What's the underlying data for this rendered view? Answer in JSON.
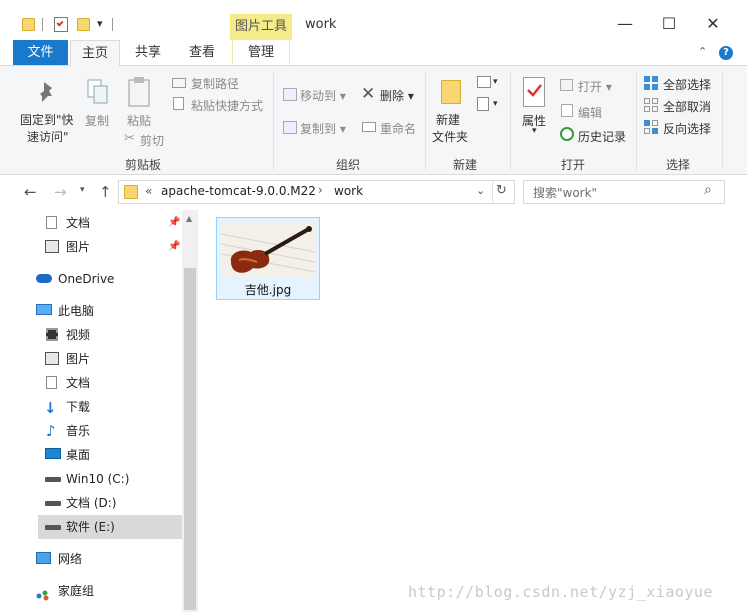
{
  "title_bar": {
    "context_tab": "图片工具",
    "window_title": "work",
    "minimize": "—",
    "maximize": "☐",
    "close": "✕"
  },
  "tabs": {
    "file": "文件",
    "home": "主页",
    "share": "共享",
    "view": "查看",
    "manage": "管理"
  },
  "ribbon": {
    "clipboard": {
      "pin_line1": "固定到\"快",
      "pin_line2": "速访问\"",
      "copy": "复制",
      "paste": "粘贴",
      "copy_path": "复制路径",
      "paste_shortcut": "粘贴快捷方式",
      "cut": "剪切",
      "label": "剪贴板"
    },
    "organize": {
      "move_to": "移动到",
      "copy_to": "复制到",
      "delete": "删除",
      "rename": "重命名",
      "label": "组织"
    },
    "new": {
      "new_folder_line1": "新建",
      "new_folder_line2": "文件夹",
      "label": "新建"
    },
    "open": {
      "properties": "属性",
      "open": "打开",
      "edit": "编辑",
      "history": "历史记录",
      "label": "打开"
    },
    "select": {
      "select_all": "全部选择",
      "select_none": "全部取消",
      "invert": "反向选择",
      "label": "选择"
    }
  },
  "address_bar": {
    "prefix": "«",
    "crumb1": "apache-tomcat-9.0.0.M22",
    "crumb_sep": "›",
    "crumb2": "work",
    "search_placeholder": "搜索\"work\""
  },
  "nav_pane": {
    "items": [
      {
        "label": "文档",
        "icon": "document-icon"
      },
      {
        "label": "图片",
        "icon": "pictures-icon"
      },
      {
        "label": "OneDrive",
        "icon": "onedrive-icon"
      },
      {
        "label": "此电脑",
        "icon": "computer-icon"
      },
      {
        "label": "视频",
        "icon": "video-icon"
      },
      {
        "label": "图片",
        "icon": "pictures-icon"
      },
      {
        "label": "文档",
        "icon": "document-icon"
      },
      {
        "label": "下载",
        "icon": "download-icon"
      },
      {
        "label": "音乐",
        "icon": "music-icon"
      },
      {
        "label": "桌面",
        "icon": "desktop-icon"
      },
      {
        "label": "Win10 (C:)",
        "icon": "drive-icon"
      },
      {
        "label": "文档 (D:)",
        "icon": "drive-icon"
      },
      {
        "label": "软件 (E:)",
        "icon": "drive-icon"
      },
      {
        "label": "网络",
        "icon": "network-icon"
      },
      {
        "label": "家庭组",
        "icon": "homegroup-icon"
      }
    ]
  },
  "files": [
    {
      "name": "吉他.jpg"
    }
  ],
  "watermark": "http://blog.csdn.net/yzj_xiaoyue",
  "colors": {
    "file_tab": "#1979ca",
    "context_tab": "#f6eb8b",
    "selection": "#e5f3ff",
    "selection_border": "#99d1ff"
  }
}
